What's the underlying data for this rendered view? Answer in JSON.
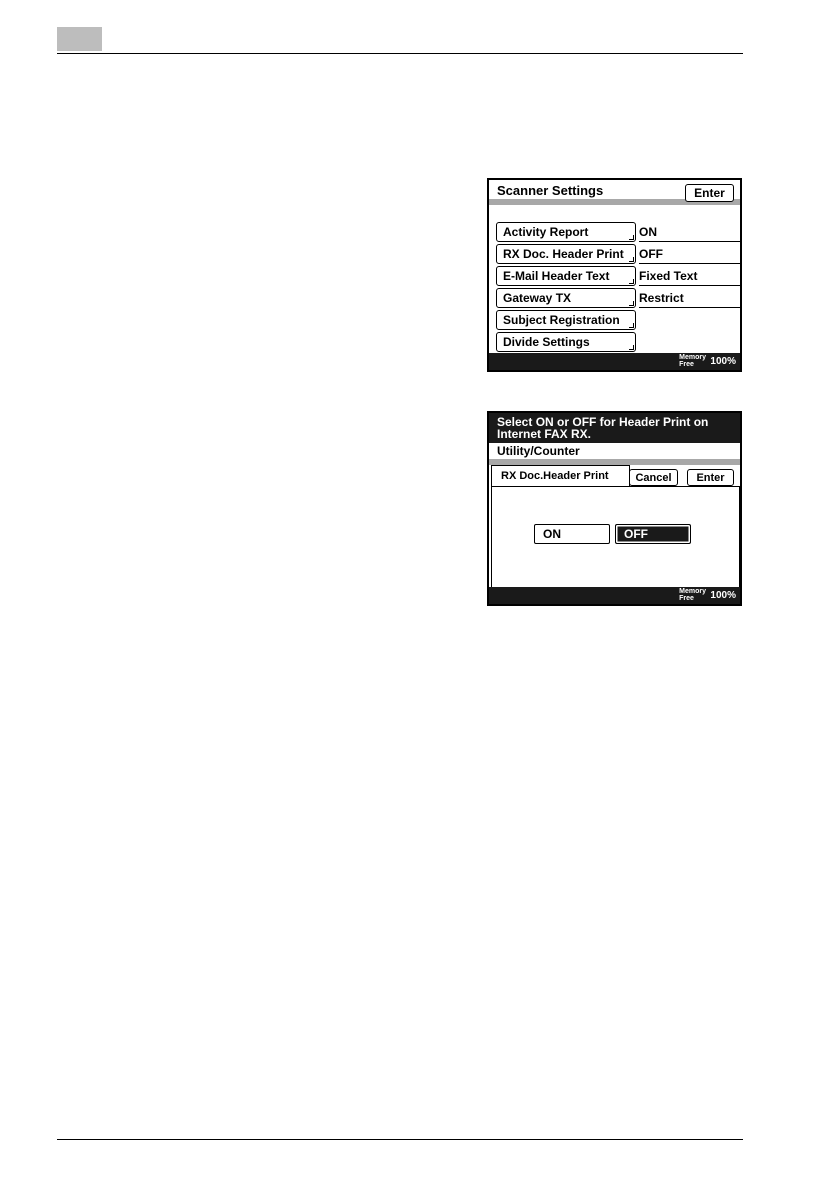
{
  "screen1": {
    "title": "Scanner Settings",
    "enter_label": "Enter",
    "items": [
      {
        "label": "Activity Report",
        "value": "ON"
      },
      {
        "label": "RX Doc. Header Print",
        "value": "OFF"
      },
      {
        "label": "E-Mail Header Text",
        "value": "Fixed Text"
      },
      {
        "label": "Gateway TX",
        "value": "Restrict"
      },
      {
        "label": "Subject Registration",
        "value": ""
      },
      {
        "label": "Divide Settings",
        "value": ""
      }
    ],
    "memory": {
      "label_line1": "Memory",
      "label_line2": "Free",
      "value": "100%"
    }
  },
  "screen2": {
    "message_line1": "Select ON or OFF for Header Print on",
    "message_line2": "Internet FAX RX.",
    "subtitle": "Utility/Counter",
    "tab_label": "RX Doc.Header Print",
    "cancel_label": "Cancel",
    "enter_label": "Enter",
    "on_label": "ON",
    "off_label": "OFF",
    "selected": "OFF",
    "memory": {
      "label_line1": "Memory",
      "label_line2": "Free",
      "value": "100%"
    }
  }
}
